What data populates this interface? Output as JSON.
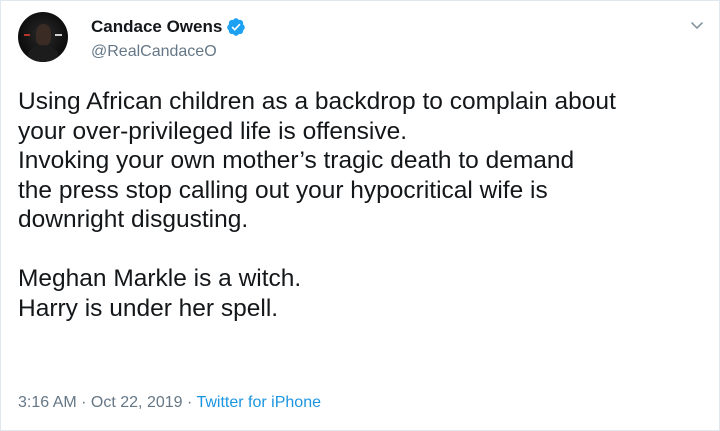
{
  "tweet": {
    "display_name": "Candace Owens",
    "handle": "@RealCandaceO",
    "verified": true,
    "text": "Using African children as a backdrop to complain about\nyour over-privileged life is offensive.\nInvoking your own mother’s tragic death to demand\nthe press stop calling out your hypocritical wife is\ndownright disgusting.\n\nMeghan Markle is a witch.\nHarry is under her spell.",
    "time": "3:16 AM",
    "separator1": " · ",
    "date": "Oct 22, 2019",
    "separator2": " · ",
    "source": "Twitter for iPhone"
  },
  "icons": {
    "verified": "verified-badge-icon",
    "menu": "chevron-down-icon",
    "avatar": "profile-avatar"
  },
  "colors": {
    "verified_blue": "#1da1f2",
    "link_blue": "#1b95e0",
    "secondary_text": "#657786",
    "primary_text": "#14171a"
  }
}
